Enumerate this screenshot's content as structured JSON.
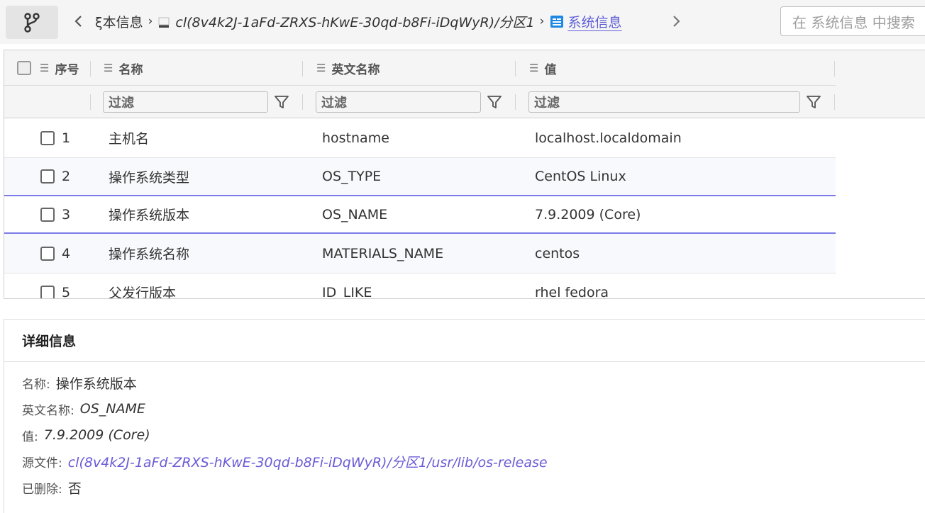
{
  "toolbar": {
    "branch_icon": "branch-icon",
    "back_icon": "chevron-left-icon",
    "forward_icon": "chevron-right-icon"
  },
  "breadcrumb": {
    "items": [
      {
        "label": "ξ本信息",
        "icon": null
      },
      {
        "label": "cl(8v4k2J-1aFd-ZRXS-hKwE-30qd-b8Fi-iDqWyR)/分区1",
        "icon": "disk-icon"
      },
      {
        "label": "系统信息",
        "icon": "system-info-icon"
      }
    ],
    "separator": "›"
  },
  "search": {
    "placeholder": "在 系统信息 中搜索"
  },
  "grid": {
    "columns": [
      {
        "label": "序号"
      },
      {
        "label": "名称"
      },
      {
        "label": "英文名称"
      },
      {
        "label": "值"
      }
    ],
    "filter_placeholder": "过滤",
    "rows": [
      {
        "num": "1",
        "name": "主机名",
        "en": "hostname",
        "val": "localhost.localdomain"
      },
      {
        "num": "2",
        "name": "操作系统类型",
        "en": "OS_TYPE",
        "val": "CentOS Linux"
      },
      {
        "num": "3",
        "name": "操作系统版本",
        "en": "OS_NAME",
        "val": "7.9.2009 (Core)"
      },
      {
        "num": "4",
        "name": "操作系统名称",
        "en": "MATERIALS_NAME",
        "val": "centos"
      },
      {
        "num": "5",
        "name": "父发行版本",
        "en": "ID_LIKE",
        "val": "rhel fedora"
      }
    ],
    "selected_row": "3"
  },
  "detail": {
    "title": "详细信息",
    "fields": [
      {
        "label": "名称:",
        "value": "操作系统版本"
      },
      {
        "label": "英文名称:",
        "value": "OS_NAME"
      },
      {
        "label": "值:",
        "value": "7.9.2009 (Core)"
      },
      {
        "label": "源文件:",
        "value": "cl(8v4k2J-1aFd-ZRXS-hKwE-30qd-b8Fi-iDqWyR)/分区1/usr/lib/os-release"
      },
      {
        "label": "已删除:",
        "value": "否"
      }
    ]
  },
  "colors": {
    "accent": "#5c5cd6",
    "link": "#6a5ad6",
    "selected_border": "#7b7be8"
  }
}
